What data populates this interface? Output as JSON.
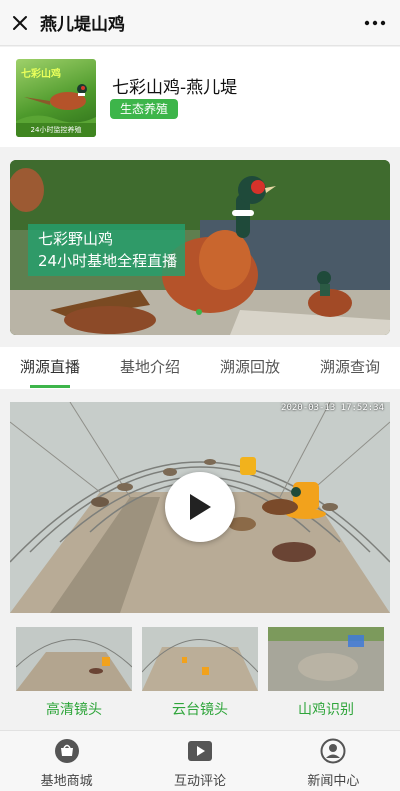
{
  "navbar": {
    "title": "燕儿堤山鸡",
    "close_icon": "close-icon",
    "more_icon": "more-dots-icon"
  },
  "channel": {
    "name": "七彩山鸡-燕儿堤",
    "tag": "生态养殖",
    "logo": {
      "text": "七彩山鸡",
      "caption": "24小时监控养殖"
    }
  },
  "banner": {
    "line1": "七彩野山鸡",
    "line2": "24小时基地全程直播",
    "accent": "#3db54a"
  },
  "tabs": [
    {
      "label": "溯源直播",
      "active": true
    },
    {
      "label": "基地介绍",
      "active": false
    },
    {
      "label": "溯源回放",
      "active": false
    },
    {
      "label": "溯源查询",
      "active": false
    }
  ],
  "video": {
    "timestamp": "2020-03-13  17:52:34",
    "play_icon": "play-icon"
  },
  "cameras": [
    {
      "label": "高清镜头"
    },
    {
      "label": "云台镜头"
    },
    {
      "label": "山鸡识别"
    }
  ],
  "bottombar": [
    {
      "label": "基地商城",
      "icon": "shop-icon"
    },
    {
      "label": "互动评论",
      "icon": "video-comment-icon"
    },
    {
      "label": "新闻中心",
      "icon": "news-center-icon"
    }
  ],
  "colors": {
    "brand_green": "#3db54a",
    "label_green": "#2fa53b"
  }
}
